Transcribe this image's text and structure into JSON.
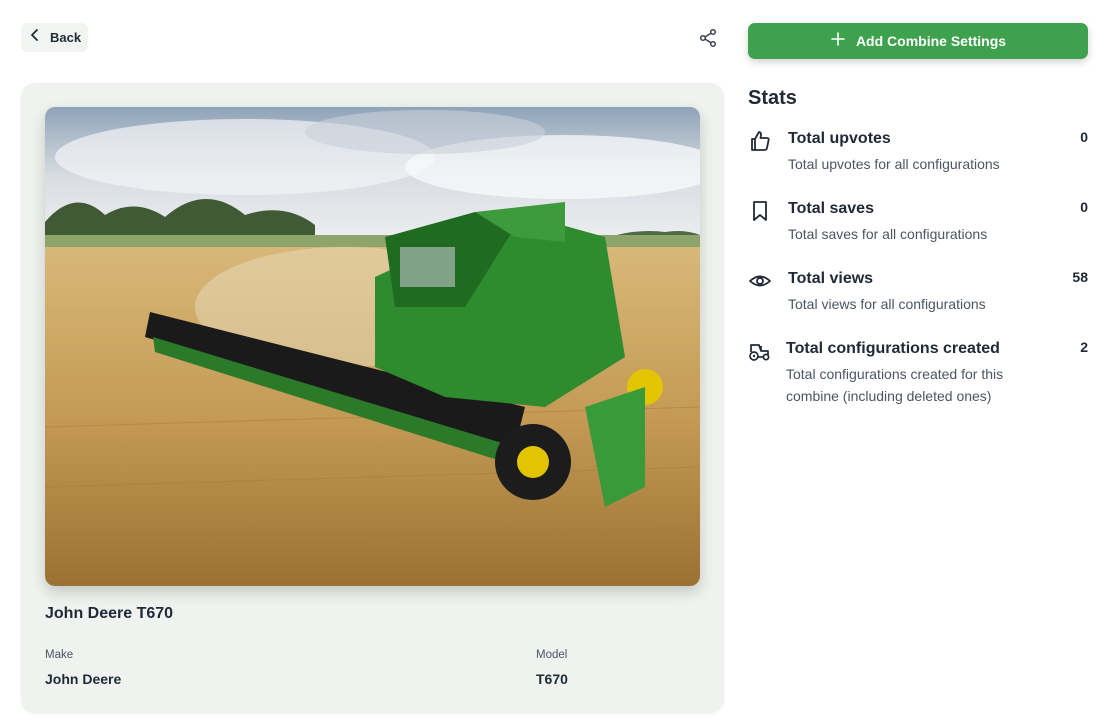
{
  "nav": {
    "back_label": "Back"
  },
  "icons": {
    "back": "chevron-left-icon",
    "share": "share-icon",
    "add": "plus-icon",
    "upvotes": "thumbs-up-icon",
    "saves": "bookmark-icon",
    "views": "eye-icon",
    "configs": "tractor-icon"
  },
  "actions": {
    "add_label": "Add Combine Settings"
  },
  "combine": {
    "title": "John Deere T670",
    "make_label": "Make",
    "make_value": "John Deere",
    "model_label": "Model",
    "model_value": "T670"
  },
  "stats": {
    "title": "Stats",
    "items": [
      {
        "name": "Total upvotes",
        "desc": "Total upvotes for all configurations",
        "value": "0"
      },
      {
        "name": "Total saves",
        "desc": "Total saves for all configurations",
        "value": "0"
      },
      {
        "name": "Total views",
        "desc": "Total views for all configurations",
        "value": "58"
      },
      {
        "name": "Total configurations created",
        "desc": "Total configurations created for this combine (including deleted ones)",
        "value": "2"
      }
    ]
  },
  "colors": {
    "primary_green": "#3ea14e",
    "card_bg": "#eff2ee",
    "text_dark": "#1f2937",
    "text_muted": "#4b5563"
  }
}
